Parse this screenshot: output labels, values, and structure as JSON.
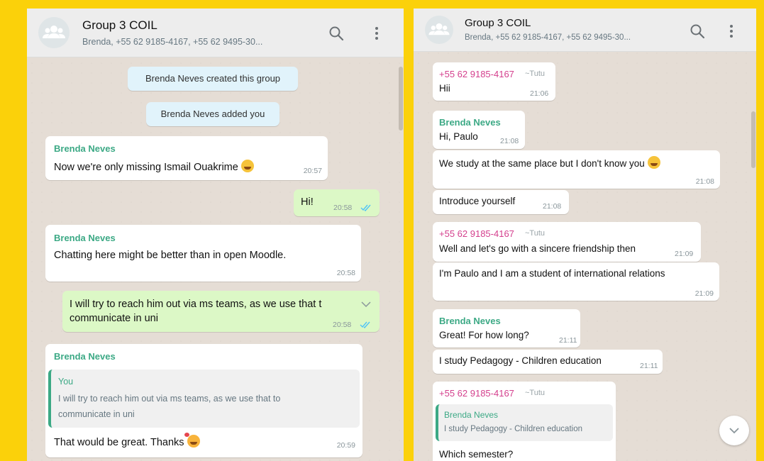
{
  "colors": {
    "background": "#FBD10A",
    "chat_bg": "#E5DDD5",
    "header_bg": "#EDEDED",
    "incoming": "#FFFFFF",
    "outgoing": "#DCF8C6",
    "system": "#E1F3FB",
    "sender_green": "#3CA985",
    "sender_pink": "#D43F8D",
    "read_ticks": "#4FC3F7"
  },
  "left": {
    "header": {
      "title": "Group 3 COIL",
      "subtitle": "Brenda, +55 62 9185-4167, +55 62 9495-30...",
      "avatar_icon": "group-avatar-icon",
      "search_icon": "search-icon",
      "menu_icon": "kebab-menu-icon"
    },
    "system": [
      "Brenda Neves created this group",
      "Brenda Neves added you"
    ],
    "messages": [
      {
        "sender": "Brenda Neves",
        "text": "Now we're only missing Ismail Ouakrime",
        "emoji": "grinning-sweat-emoji",
        "time": "20:57"
      },
      {
        "text": "Hi!",
        "time": "20:58"
      },
      {
        "sender": "Brenda Neves",
        "text": "Chatting here might be better than in open Moodle.",
        "time": "20:58"
      },
      {
        "line1": "I will try to reach him out via ms teams, as we use that t",
        "line2": "communicate in uni",
        "time": "20:58"
      },
      {
        "sender": "Brenda Neves",
        "quote_sender": "You",
        "quote_line1": "I will try to reach him out via ms teams, as we use that to",
        "quote_line2": "communicate in uni",
        "text": "That would be great. Thanks",
        "emoji": "smiling-hearts-emoji",
        "time": "20:59"
      }
    ]
  },
  "right": {
    "header": {
      "title": "Group 3 COIL",
      "subtitle": "Brenda, +55 62 9185-4167, +55 62 9495-30...",
      "avatar_icon": "group-avatar-icon",
      "search_icon": "search-icon",
      "menu_icon": "kebab-menu-icon"
    },
    "messages": [
      {
        "sender": "+55 62 9185-4167",
        "tag": "~Tutu",
        "text": "Hii",
        "time": "21:06"
      },
      {
        "sender": "Brenda Neves",
        "text": "Hi, Paulo",
        "time": "21:08"
      },
      {
        "text": "We study at the same place but I don't know you",
        "emoji": "grinning-sweat-emoji",
        "time": "21:08"
      },
      {
        "text": "Introduce yourself",
        "time": "21:08"
      },
      {
        "sender": "+55 62 9185-4167",
        "tag": "~Tutu",
        "text": "Well and let's go with a sincere friendship then",
        "time": "21:09"
      },
      {
        "text": "I'm Paulo and I am a student of international relations",
        "time": "21:09"
      },
      {
        "sender": "Brenda Neves",
        "text": "Great! For how long?",
        "time": "21:11"
      },
      {
        "text": "I study Pedagogy - Children education",
        "time": "21:11"
      },
      {
        "sender": "+55 62 9185-4167",
        "tag": "~Tutu",
        "quote_sender": "Brenda Neves",
        "quote_text": "I study Pedagogy - Children education",
        "text": "Which semester?"
      }
    ],
    "scroll_down_icon": "chevron-down-icon"
  }
}
